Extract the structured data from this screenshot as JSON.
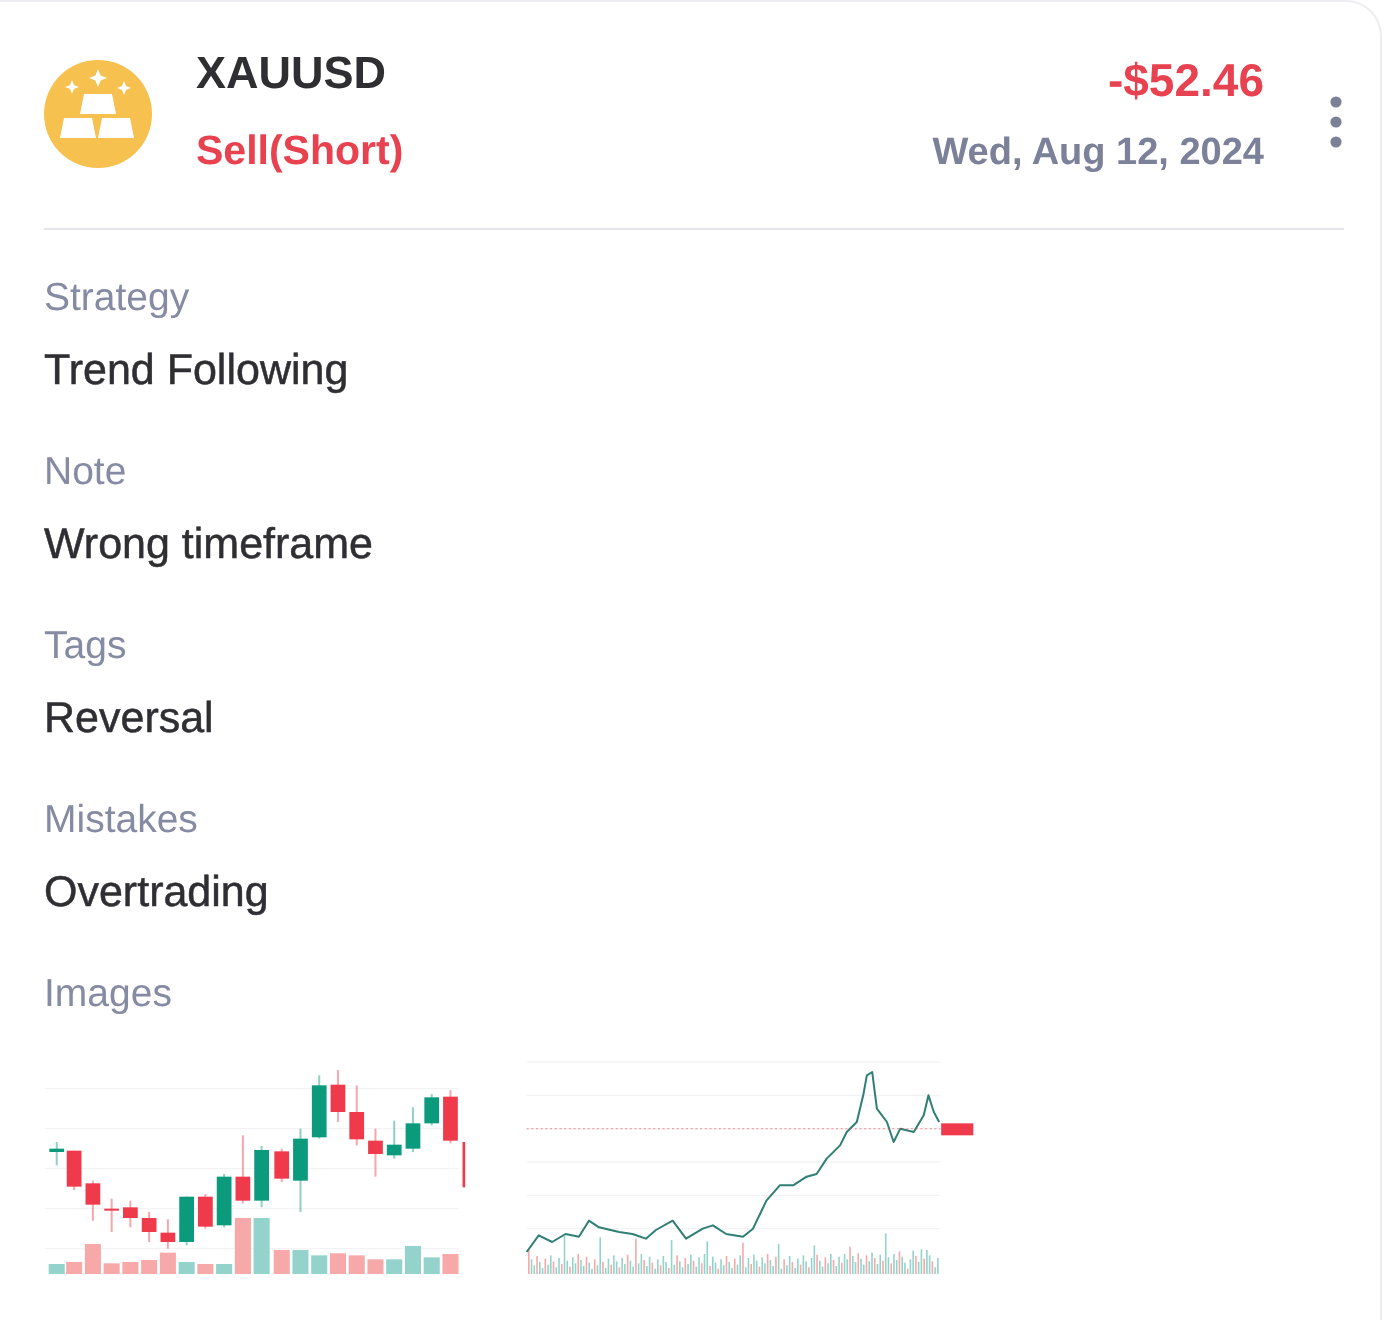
{
  "trade": {
    "symbol": "XAUUSD",
    "side": "Sell(Short)",
    "short": true,
    "pnl": "-$52.46",
    "loss": true,
    "date": "Wed, Aug 12, 2024"
  },
  "details": [
    {
      "label": "Strategy",
      "value": "Trend Following"
    },
    {
      "label": "Note",
      "value": "Wrong timeframe"
    },
    {
      "label": "Tags",
      "value": "Reversal"
    },
    {
      "label": "Mistakes",
      "value": "Overtrading"
    }
  ],
  "images": {
    "label": "Images",
    "items": [
      {
        "kind": "candlestick"
      },
      {
        "kind": "line"
      }
    ]
  }
}
